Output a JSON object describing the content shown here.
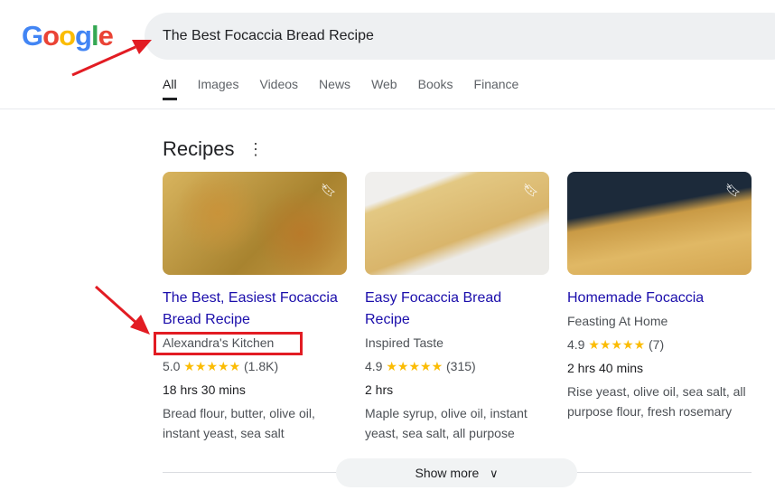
{
  "logo": {
    "letters": [
      "G",
      "o",
      "o",
      "g",
      "l",
      "e"
    ],
    "colors": [
      "#4285f4",
      "#ea4335",
      "#fbbc05",
      "#4285f4",
      "#34a853",
      "#ea4335"
    ]
  },
  "search": {
    "value": "The Best Focaccia Bread Recipe"
  },
  "tabs": [
    {
      "label": "All"
    },
    {
      "label": "Images"
    },
    {
      "label": "Videos"
    },
    {
      "label": "News"
    },
    {
      "label": "Web"
    },
    {
      "label": "Books"
    },
    {
      "label": "Finance"
    }
  ],
  "recipes": {
    "heading": "Recipes",
    "more_icon": "more-vert-icon",
    "show_more": "Show more",
    "chevron": "⌄",
    "cards": [
      {
        "title": "The Best, Easiest Focaccia Bread Recipe",
        "source": "Alexandra's Kitchen",
        "rating": "5.0",
        "stars": "★★★★★",
        "reviews": "(1.8K)",
        "time": "18 hrs 30 mins",
        "ingredients": "Bread flour, butter, olive oil, instant yeast, sea salt"
      },
      {
        "title": "Easy Focaccia Bread Recipe",
        "source": "Inspired Taste",
        "rating": "4.9",
        "stars": "★★★★★",
        "reviews": "(315)",
        "time": "2 hrs",
        "ingredients": "Maple syrup, olive oil, instant yeast, sea salt, all purpose"
      },
      {
        "title": "Homemade Focaccia",
        "source": "Feasting At Home",
        "rating": "4.9",
        "stars": "★★★★★",
        "reviews": "(7)",
        "time": "2 hrs 40 mins",
        "ingredients": "Rise yeast, olive oil, sea salt, all purpose flour, fresh rosemary"
      }
    ]
  },
  "annotation_color": "#e21c23"
}
